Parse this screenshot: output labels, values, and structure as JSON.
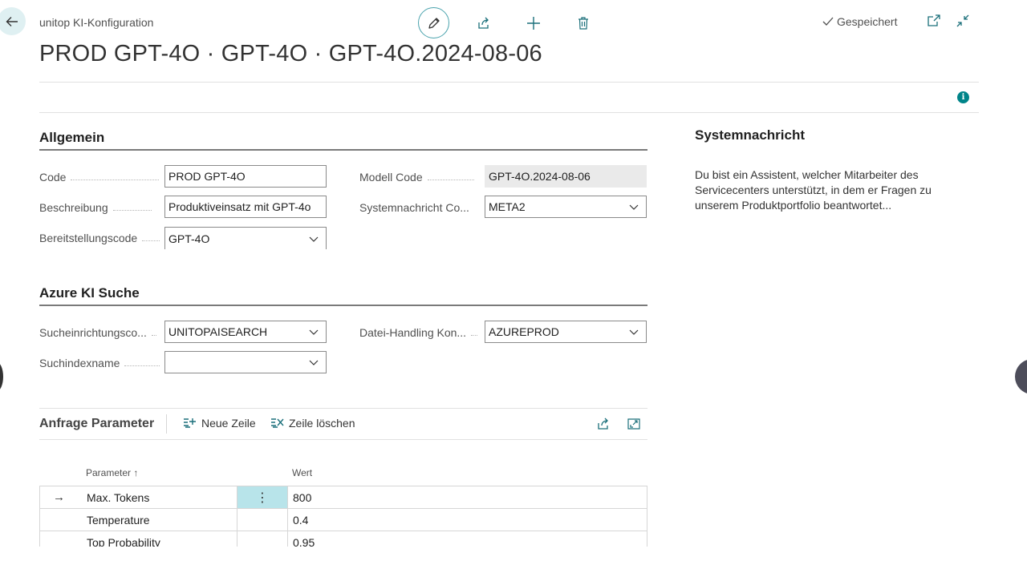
{
  "header": {
    "breadcrumb": "unitop KI-Konfiguration",
    "title": "PROD GPT-4O · GPT-4O · GPT-4O.2024-08-06",
    "saved_label": "Gespeichert"
  },
  "icons": {
    "back": "arrow-left-icon",
    "edit": "pencil-icon",
    "share": "share-icon",
    "new": "plus-icon",
    "delete": "trash-icon",
    "open_new_window": "open-in-new-window-icon",
    "collapse": "collapse-icon",
    "info": "info-icon"
  },
  "general": {
    "title": "Allgemein",
    "fields": {
      "code": {
        "label": "Code",
        "value": "PROD GPT-4O"
      },
      "description": {
        "label": "Beschreibung",
        "value": "Produktiveinsatz mit GPT-4o"
      },
      "deployment": {
        "label": "Bereitstellungscode",
        "value": "GPT-4O"
      },
      "model_code": {
        "label": "Modell Code",
        "value": "GPT-4O.2024-08-06"
      },
      "system_message_code": {
        "label": "Systemnachricht Co...",
        "value": "META2"
      }
    }
  },
  "azure": {
    "title": "Azure KI Suche",
    "fields": {
      "search_service": {
        "label": "Sucheinrichtungsco...",
        "value": "UNITOPAISEARCH"
      },
      "search_index": {
        "label": "Suchindexname",
        "value": ""
      },
      "file_handling": {
        "label": "Datei-Handling Kon...",
        "value": "AZUREPROD"
      }
    }
  },
  "system_message": {
    "title": "Systemnachricht",
    "text": "Du bist ein Assistent, welcher Mitarbeiter des Servicecenters unterstützt, in dem er Fragen zu unserem Produktportfolio beantwortet..."
  },
  "parameters": {
    "title": "Anfrage Parameter",
    "new_line": "Neue Zeile",
    "delete_line": "Zeile löschen",
    "col_param": "Parameter ↑",
    "col_value": "Wert",
    "rows": [
      {
        "param": "Max. Tokens",
        "value": "800",
        "arrow": "→",
        "menu": "⋮"
      },
      {
        "param": "Temperature",
        "value": "0.4",
        "arrow": "",
        "menu": ""
      },
      {
        "param": "Top Probability",
        "value": "0.95",
        "arrow": "",
        "menu": ""
      }
    ]
  },
  "colors": {
    "accent": "#008489",
    "selected_cell": "#b8e4ea"
  }
}
